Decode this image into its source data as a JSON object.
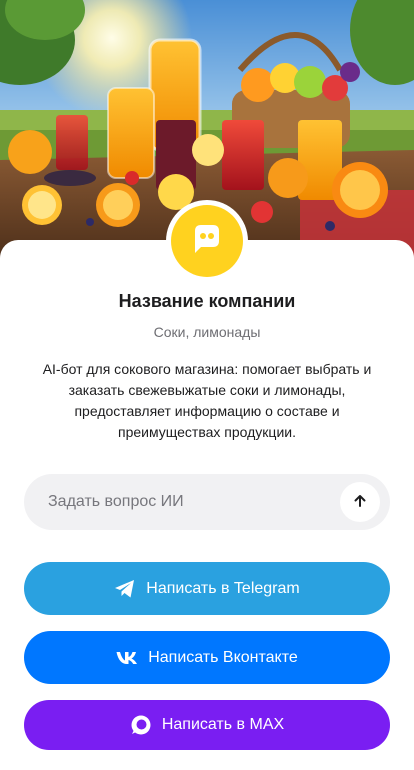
{
  "company": {
    "name": "Название компании",
    "subtitle": "Соки, лимонады",
    "description": "AI-бот для сокового магазина: помогает выбрать и заказать свежевыжатые соки и лимонады, предоставляет информацию о составе и преимуществах продукции."
  },
  "ask": {
    "placeholder": "Задать вопрос ИИ"
  },
  "buttons": {
    "telegram": "Написать в Telegram",
    "vk": "Написать Вконтакте",
    "max": "Написать в MAX"
  },
  "icons": {
    "avatar": "chat-bubble-icon",
    "send": "arrow-up-icon",
    "telegram": "telegram-icon",
    "vk": "vk-icon",
    "max": "max-icon"
  },
  "colors": {
    "avatar": "#ffd21f",
    "telegram": "#2aa1e0",
    "vk": "#0077ff",
    "max": "#7a1ef2",
    "input_bg": "#f1f1f3"
  }
}
